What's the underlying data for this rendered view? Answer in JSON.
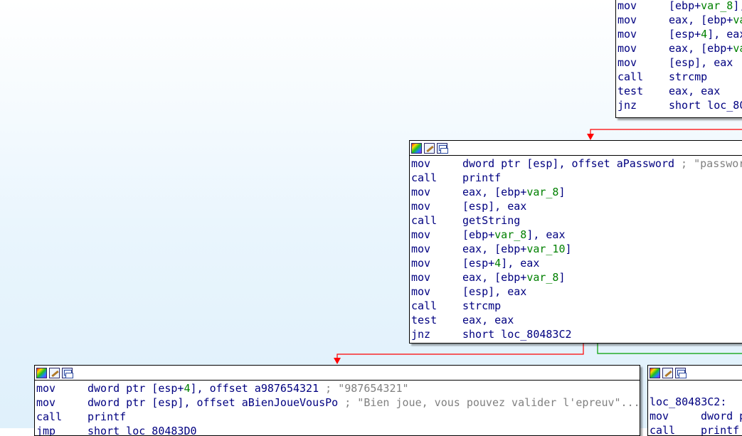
{
  "top_block": {
    "lines": [
      {
        "mnemonic": "mov",
        "segments": [
          {
            "t": "[ebp+",
            "c": "tx"
          },
          {
            "t": "var_8",
            "c": "gv"
          },
          {
            "t": "],",
            "c": "tx"
          }
        ]
      },
      {
        "mnemonic": "mov",
        "segments": [
          {
            "t": "eax, [ebp+",
            "c": "tx"
          },
          {
            "t": "va",
            "c": "gv"
          }
        ]
      },
      {
        "mnemonic": "mov",
        "segments": [
          {
            "t": "[esp+",
            "c": "tx"
          },
          {
            "t": "4",
            "c": "gv"
          },
          {
            "t": "], eax",
            "c": "tx"
          }
        ]
      },
      {
        "mnemonic": "mov",
        "segments": [
          {
            "t": "eax, [ebp+",
            "c": "tx"
          },
          {
            "t": "va",
            "c": "gv"
          }
        ]
      },
      {
        "mnemonic": "mov",
        "segments": [
          {
            "t": "[esp], eax",
            "c": "tx"
          }
        ]
      },
      {
        "mnemonic": "call",
        "segments": [
          {
            "t": "strcmp",
            "c": "tx"
          }
        ]
      },
      {
        "mnemonic": "test",
        "segments": [
          {
            "t": "eax, eax",
            "c": "tx"
          }
        ]
      },
      {
        "mnemonic": "jnz",
        "segments": [
          {
            "t": "short loc_80",
            "c": "tx"
          }
        ]
      }
    ]
  },
  "middle_block": {
    "lines": [
      {
        "mnemonic": "mov",
        "segments": [
          {
            "t": "dword ptr [esp], offset aPassword",
            "c": "tx"
          },
          {
            "t": " ; \"passwor",
            "c": "cm"
          }
        ]
      },
      {
        "mnemonic": "call",
        "segments": [
          {
            "t": "printf",
            "c": "tx"
          }
        ]
      },
      {
        "mnemonic": "mov",
        "segments": [
          {
            "t": "eax, [ebp+",
            "c": "tx"
          },
          {
            "t": "var_8",
            "c": "gv"
          },
          {
            "t": "]",
            "c": "tx"
          }
        ]
      },
      {
        "mnemonic": "mov",
        "segments": [
          {
            "t": "[esp], eax",
            "c": "tx"
          }
        ]
      },
      {
        "mnemonic": "call",
        "segments": [
          {
            "t": "getString",
            "c": "tx"
          }
        ]
      },
      {
        "mnemonic": "mov",
        "segments": [
          {
            "t": "[ebp+",
            "c": "tx"
          },
          {
            "t": "var_8",
            "c": "gv"
          },
          {
            "t": "], eax",
            "c": "tx"
          }
        ]
      },
      {
        "mnemonic": "mov",
        "segments": [
          {
            "t": "eax, [ebp+",
            "c": "tx"
          },
          {
            "t": "var_10",
            "c": "gv"
          },
          {
            "t": "]",
            "c": "tx"
          }
        ]
      },
      {
        "mnemonic": "mov",
        "segments": [
          {
            "t": "[esp+",
            "c": "tx"
          },
          {
            "t": "4",
            "c": "gv"
          },
          {
            "t": "], eax",
            "c": "tx"
          }
        ]
      },
      {
        "mnemonic": "mov",
        "segments": [
          {
            "t": "eax, [ebp+",
            "c": "tx"
          },
          {
            "t": "var_8",
            "c": "gv"
          },
          {
            "t": "]",
            "c": "tx"
          }
        ]
      },
      {
        "mnemonic": "mov",
        "segments": [
          {
            "t": "[esp], eax",
            "c": "tx"
          }
        ]
      },
      {
        "mnemonic": "call",
        "segments": [
          {
            "t": "strcmp",
            "c": "tx"
          }
        ]
      },
      {
        "mnemonic": "test",
        "segments": [
          {
            "t": "eax, eax",
            "c": "tx"
          }
        ]
      },
      {
        "mnemonic": "jnz",
        "segments": [
          {
            "t": "short loc_80483C2",
            "c": "tx"
          }
        ]
      }
    ]
  },
  "bottom_left_block": {
    "lines": [
      {
        "mnemonic": "mov",
        "segments": [
          {
            "t": "dword ptr [esp+",
            "c": "tx"
          },
          {
            "t": "4",
            "c": "gv"
          },
          {
            "t": "], offset a987654321",
            "c": "tx"
          },
          {
            "t": " ; \"987654321\"",
            "c": "cm"
          }
        ]
      },
      {
        "mnemonic": "mov",
        "segments": [
          {
            "t": "dword ptr [esp], offset aBienJoueVousPo",
            "c": "tx"
          },
          {
            "t": " ; \"Bien joue, vous pouvez valider l'epreuv\"...",
            "c": "cm"
          }
        ]
      },
      {
        "mnemonic": "call",
        "segments": [
          {
            "t": "printf",
            "c": "tx"
          }
        ]
      },
      {
        "mnemonic": "jmp",
        "segments": [
          {
            "t": "short loc_80483D0",
            "c": "tx"
          }
        ]
      }
    ]
  },
  "bottom_right_block": {
    "label": "loc_80483C2:",
    "lines": [
      {
        "mnemonic": "mov",
        "segments": [
          {
            "t": "dword p",
            "c": "tx"
          }
        ]
      },
      {
        "mnemonic": "call",
        "segments": [
          {
            "t": "printf",
            "c": "tx"
          }
        ]
      }
    ]
  },
  "colors": {
    "edge_false": "#ff0000",
    "edge_true": "#00a000",
    "mnemonic": "#000080",
    "variable": "#008000",
    "comment": "#808080"
  },
  "icons": [
    "color-palette-icon",
    "rename-pencil-icon",
    "group-nodes-icon"
  ]
}
